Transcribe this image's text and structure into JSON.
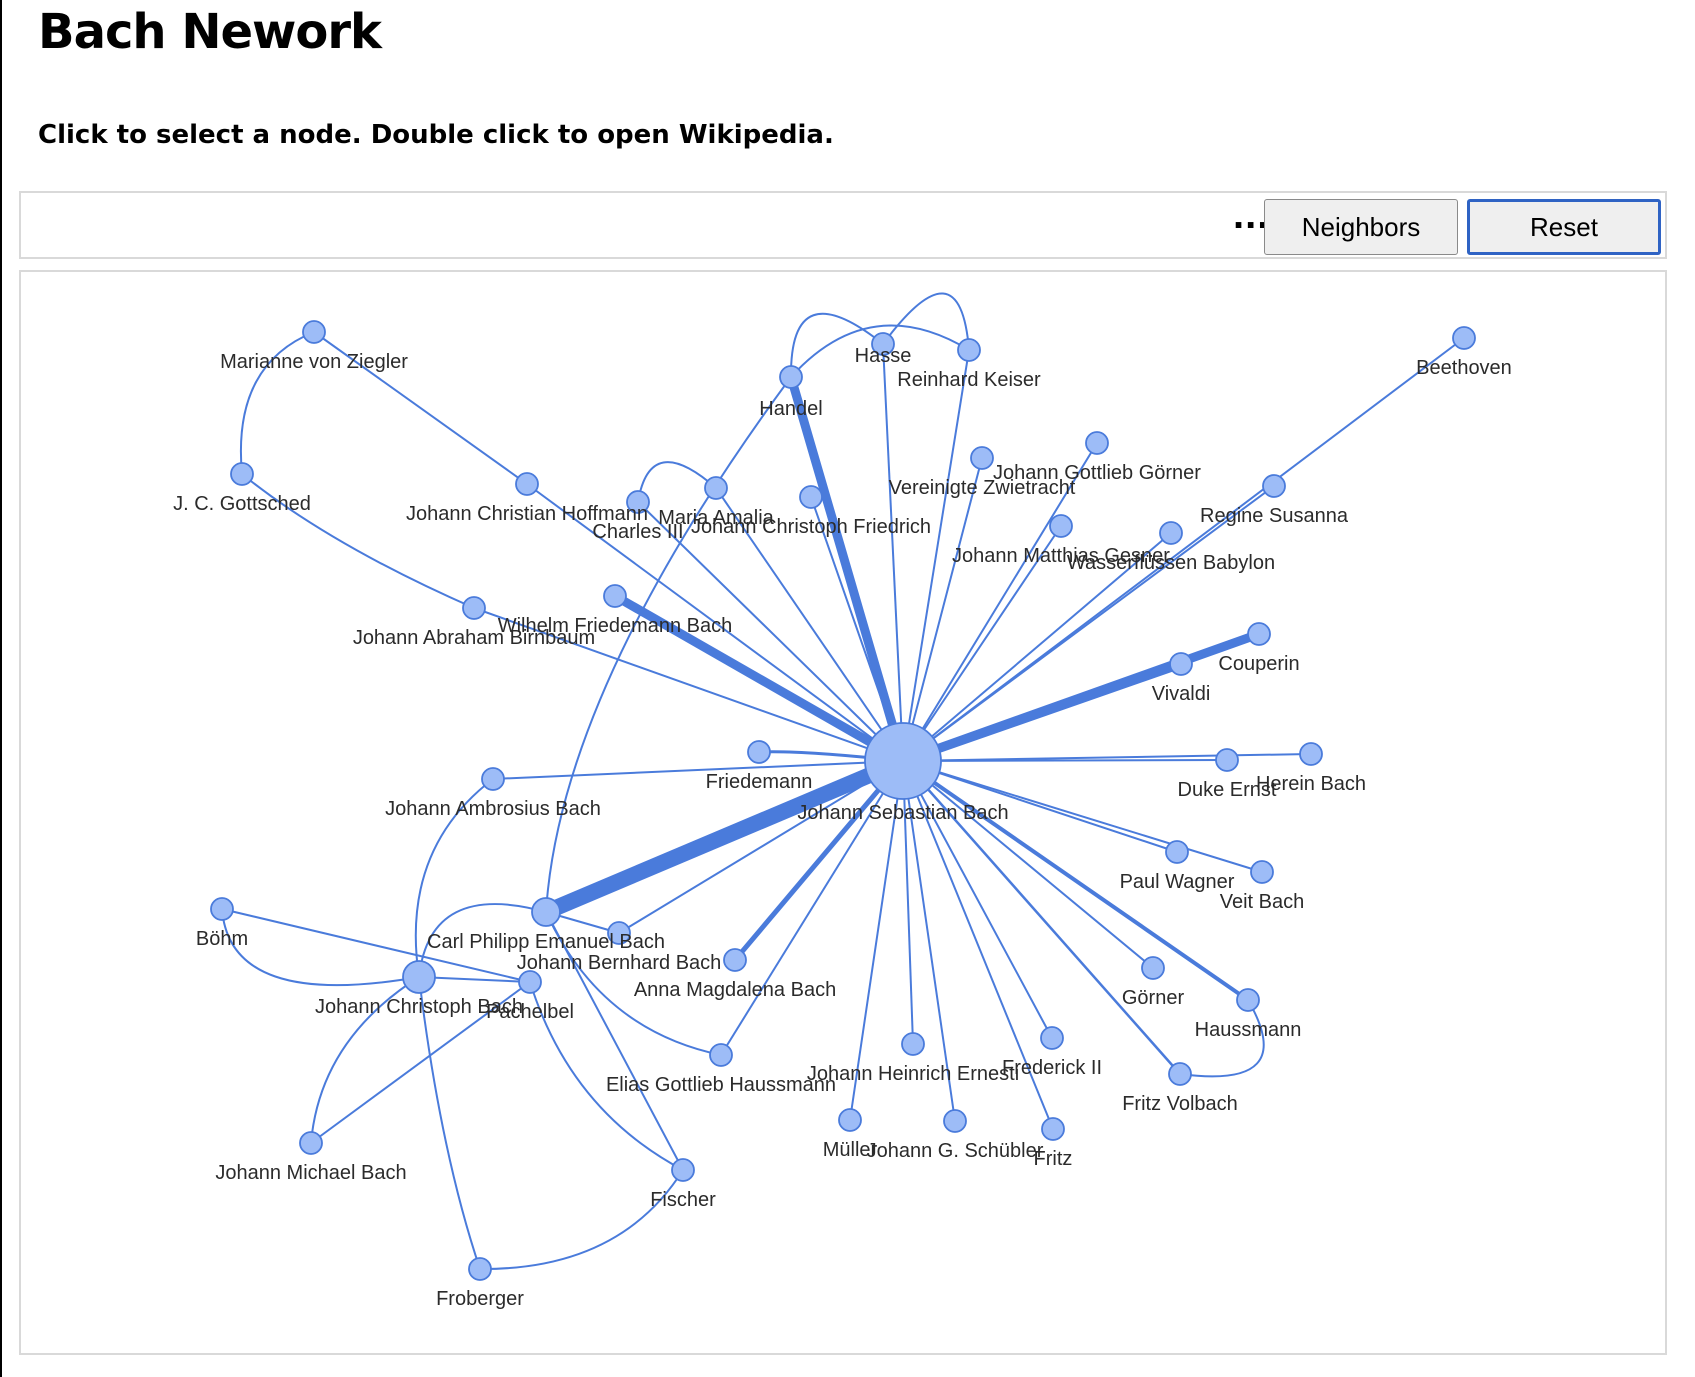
{
  "page": {
    "title": "Bach Nework",
    "instructions": "Click to select a node. Double click to open Wikipedia."
  },
  "toolbar": {
    "more_label": "...",
    "neighbors_label": "Neighbors",
    "reset_label": "Reset"
  },
  "colors": {
    "edge": "#4a7bdb",
    "node_fill": "#9dbcf7",
    "selected_border": "#2f63c4"
  },
  "network": {
    "nodes": [
      {
        "id": "jsb",
        "label": "Johann Sebastian Bach"
      },
      {
        "id": "ziegler",
        "label": "Marianne von Ziegler"
      },
      {
        "id": "gottsched",
        "label": "J. C. Gottsched"
      },
      {
        "id": "hoffmann",
        "label": "Johann Christian Hoffmann"
      },
      {
        "id": "birnbaum",
        "label": "Johann Abraham Birnbaum"
      },
      {
        "id": "handel",
        "label": "Handel"
      },
      {
        "id": "hasse",
        "label": "Hasse"
      },
      {
        "id": "keiser",
        "label": "Reinhard Keiser"
      },
      {
        "id": "beethoven",
        "label": "Beethoven"
      },
      {
        "id": "charles",
        "label": "Charles III"
      },
      {
        "id": "amalia",
        "label": "Maria Amalia"
      },
      {
        "id": "jcf",
        "label": "Johann Christoph Friedrich"
      },
      {
        "id": "zwietracht",
        "label": "Vereinigte Zwietracht"
      },
      {
        "id": "gorner_jg",
        "label": "Johann Gottlieb Görner"
      },
      {
        "id": "gesner",
        "label": "Johann Matthias Gesner"
      },
      {
        "id": "babylon",
        "label": "Wasserflüssen Babylon"
      },
      {
        "id": "regine",
        "label": "Regine Susanna"
      },
      {
        "id": "wfb",
        "label": "Wilhelm Friedemann Bach"
      },
      {
        "id": "couperin",
        "label": "Couperin"
      },
      {
        "id": "vivaldi",
        "label": "Vivaldi"
      },
      {
        "id": "friedemann",
        "label": "Friedemann"
      },
      {
        "id": "jab",
        "label": "Johann Ambrosius Bach"
      },
      {
        "id": "duke",
        "label": "Duke Ernst"
      },
      {
        "id": "herein",
        "label": "Herein Bach"
      },
      {
        "id": "wagner",
        "label": "Paul Wagner"
      },
      {
        "id": "veit",
        "label": "Veit Bach"
      },
      {
        "id": "cpe",
        "label": "Carl Philipp Emanuel Bach"
      },
      {
        "id": "jbb",
        "label": "Johann Bernhard Bach"
      },
      {
        "id": "amb",
        "label": "Anna Magdalena Bach"
      },
      {
        "id": "bohm",
        "label": "Böhm"
      },
      {
        "id": "jcb",
        "label": "Johann Christoph Bach"
      },
      {
        "id": "pachelbel",
        "label": "Pachelbel"
      },
      {
        "id": "egh",
        "label": "Elias Gottlieb Haussmann"
      },
      {
        "id": "ernesti",
        "label": "Johann Heinrich Ernesti"
      },
      {
        "id": "frederick",
        "label": "Frederick II"
      },
      {
        "id": "gorner",
        "label": "Görner"
      },
      {
        "id": "haussmann",
        "label": "Haussmann"
      },
      {
        "id": "volbach",
        "label": "Fritz Volbach"
      },
      {
        "id": "muller",
        "label": "Müller"
      },
      {
        "id": "schubler",
        "label": "Johann G. Schübler"
      },
      {
        "id": "fritz",
        "label": "Fritz"
      },
      {
        "id": "jmb",
        "label": "Johann Michael Bach"
      },
      {
        "id": "fischer",
        "label": "Fischer"
      },
      {
        "id": "froberger",
        "label": "Froberger"
      }
    ],
    "edges": [
      [
        "jsb",
        "handel"
      ],
      [
        "jsb",
        "hasse"
      ],
      [
        "jsb",
        "keiser"
      ],
      [
        "jsb",
        "beethoven"
      ],
      [
        "jsb",
        "charles"
      ],
      [
        "jsb",
        "amalia"
      ],
      [
        "jsb",
        "jcf"
      ],
      [
        "jsb",
        "zwietracht"
      ],
      [
        "jsb",
        "gorner_jg"
      ],
      [
        "jsb",
        "gesner"
      ],
      [
        "jsb",
        "babylon"
      ],
      [
        "jsb",
        "regine"
      ],
      [
        "jsb",
        "wfb"
      ],
      [
        "jsb",
        "couperin"
      ],
      [
        "jsb",
        "vivaldi"
      ],
      [
        "jsb",
        "friedemann"
      ],
      [
        "jsb",
        "jab"
      ],
      [
        "jsb",
        "duke"
      ],
      [
        "jsb",
        "herein"
      ],
      [
        "jsb",
        "wagner"
      ],
      [
        "jsb",
        "veit"
      ],
      [
        "jsb",
        "cpe"
      ],
      [
        "jsb",
        "jbb"
      ],
      [
        "jsb",
        "amb"
      ],
      [
        "jsb",
        "egh"
      ],
      [
        "jsb",
        "ernesti"
      ],
      [
        "jsb",
        "frederick"
      ],
      [
        "jsb",
        "gorner"
      ],
      [
        "jsb",
        "haussmann"
      ],
      [
        "jsb",
        "volbach"
      ],
      [
        "jsb",
        "muller"
      ],
      [
        "jsb",
        "schubler"
      ],
      [
        "jsb",
        "fritz"
      ],
      [
        "jsb",
        "hoffmann"
      ],
      [
        "jsb",
        "birnbaum"
      ],
      [
        "ziegler",
        "gottsched"
      ],
      [
        "ziegler",
        "hoffmann"
      ],
      [
        "gottsched",
        "birnbaum"
      ],
      [
        "handel",
        "hasse"
      ],
      [
        "handel",
        "keiser"
      ],
      [
        "hasse",
        "keiser"
      ],
      [
        "charles",
        "amalia"
      ],
      [
        "handel",
        "cpe"
      ],
      [
        "cpe",
        "jbb"
      ],
      [
        "cpe",
        "jcb"
      ],
      [
        "cpe",
        "egh"
      ],
      [
        "cpe",
        "fischer"
      ],
      [
        "bohm",
        "jcb"
      ],
      [
        "bohm",
        "pachelbel"
      ],
      [
        "jcb",
        "jmb"
      ],
      [
        "jcb",
        "pachelbel"
      ],
      [
        "jcb",
        "froberger"
      ],
      [
        "jcb",
        "jab"
      ],
      [
        "pachelbel",
        "fischer"
      ],
      [
        "pachelbel",
        "jmb"
      ],
      [
        "fischer",
        "froberger"
      ],
      [
        "haussmann",
        "volbach"
      ]
    ]
  }
}
